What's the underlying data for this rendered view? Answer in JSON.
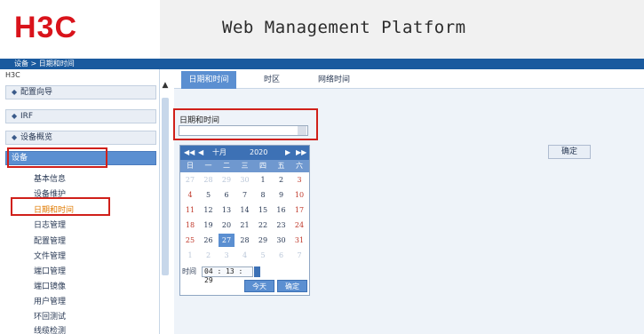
{
  "header": {
    "logo_text": "H3C",
    "title": "Web Management Platform",
    "brand_color": "#d9131b"
  },
  "breadcrumb": "设备 > 日期和时间",
  "sidebar": {
    "root": "H3C",
    "top_items": [
      {
        "label": "配置向导"
      },
      {
        "label": "IRF"
      },
      {
        "label": "设备概览"
      }
    ],
    "active_section": "设备",
    "sub_items": [
      {
        "label": "基本信息"
      },
      {
        "label": "设备维护"
      },
      {
        "label": "日期和时间"
      },
      {
        "label": "日志管理"
      },
      {
        "label": "配置管理"
      },
      {
        "label": "文件管理"
      },
      {
        "label": "端口管理"
      },
      {
        "label": "端口镜像"
      },
      {
        "label": "用户管理"
      },
      {
        "label": "环回测试"
      },
      {
        "label": "线缆检测"
      }
    ],
    "selected_sub_item": "日期和时间"
  },
  "tabs": [
    {
      "label": "日期和时间",
      "active": true
    },
    {
      "label": "时区",
      "active": false
    },
    {
      "label": "网络时间",
      "active": false
    }
  ],
  "form": {
    "field_label": "日期和时间",
    "ok_label": "确定"
  },
  "calendar": {
    "month": "十月",
    "year": "2020",
    "weekdays": [
      "日",
      "一",
      "二",
      "三",
      "四",
      "五",
      "六"
    ],
    "days": [
      {
        "d": "27",
        "k": "dim"
      },
      {
        "d": "28",
        "k": "dim"
      },
      {
        "d": "29",
        "k": "dim"
      },
      {
        "d": "30",
        "k": "dim"
      },
      {
        "d": "1",
        "k": "norm"
      },
      {
        "d": "2",
        "k": "norm"
      },
      {
        "d": "3",
        "k": "wknd"
      },
      {
        "d": "4",
        "k": "wknd"
      },
      {
        "d": "5",
        "k": "norm"
      },
      {
        "d": "6",
        "k": "norm"
      },
      {
        "d": "7",
        "k": "norm"
      },
      {
        "d": "8",
        "k": "norm"
      },
      {
        "d": "9",
        "k": "norm"
      },
      {
        "d": "10",
        "k": "wknd"
      },
      {
        "d": "11",
        "k": "wknd"
      },
      {
        "d": "12",
        "k": "norm"
      },
      {
        "d": "13",
        "k": "norm"
      },
      {
        "d": "14",
        "k": "norm"
      },
      {
        "d": "15",
        "k": "norm"
      },
      {
        "d": "16",
        "k": "norm"
      },
      {
        "d": "17",
        "k": "wknd"
      },
      {
        "d": "18",
        "k": "wknd"
      },
      {
        "d": "19",
        "k": "norm"
      },
      {
        "d": "20",
        "k": "norm"
      },
      {
        "d": "21",
        "k": "norm"
      },
      {
        "d": "22",
        "k": "norm"
      },
      {
        "d": "23",
        "k": "norm"
      },
      {
        "d": "24",
        "k": "wknd"
      },
      {
        "d": "25",
        "k": "wknd"
      },
      {
        "d": "26",
        "k": "norm"
      },
      {
        "d": "27",
        "k": "today"
      },
      {
        "d": "28",
        "k": "norm"
      },
      {
        "d": "29",
        "k": "norm"
      },
      {
        "d": "30",
        "k": "norm"
      },
      {
        "d": "31",
        "k": "wknd"
      },
      {
        "d": "1",
        "k": "dim"
      },
      {
        "d": "2",
        "k": "dim"
      },
      {
        "d": "3",
        "k": "dim"
      },
      {
        "d": "4",
        "k": "dim"
      },
      {
        "d": "5",
        "k": "dim"
      },
      {
        "d": "6",
        "k": "dim"
      },
      {
        "d": "7",
        "k": "dim"
      }
    ],
    "time_label": "时间",
    "time_value": "04 : 13 : 29",
    "today_label": "今天",
    "confirm_label": "确定",
    "nav": {
      "prev_year": "◀◀",
      "prev_month": "◀",
      "next_month": "▶",
      "next_year": "▶▶"
    }
  },
  "colors": {
    "accent": "#5b8fd1",
    "breadcrumb_bar": "#1a5a9e",
    "highlight": "#d0201a",
    "selected_text": "#e07a00"
  }
}
